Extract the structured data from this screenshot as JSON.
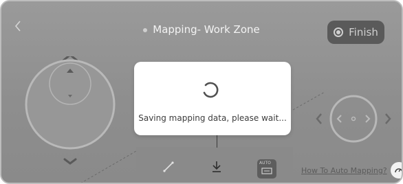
{
  "header": {
    "title": "Mapping- Work Zone",
    "finish_label": "Finish"
  },
  "modal": {
    "message": "Saving mapping data, please wait..."
  },
  "bottom": {
    "auto_badge": "AUTO",
    "help_link": "How To Auto Mapping?"
  },
  "colors": {
    "overlay": "#8f8f8f",
    "finish_button": "#5a5a5a",
    "modal_bg": "#ffffff",
    "text_dark": "#3c3c3c"
  }
}
